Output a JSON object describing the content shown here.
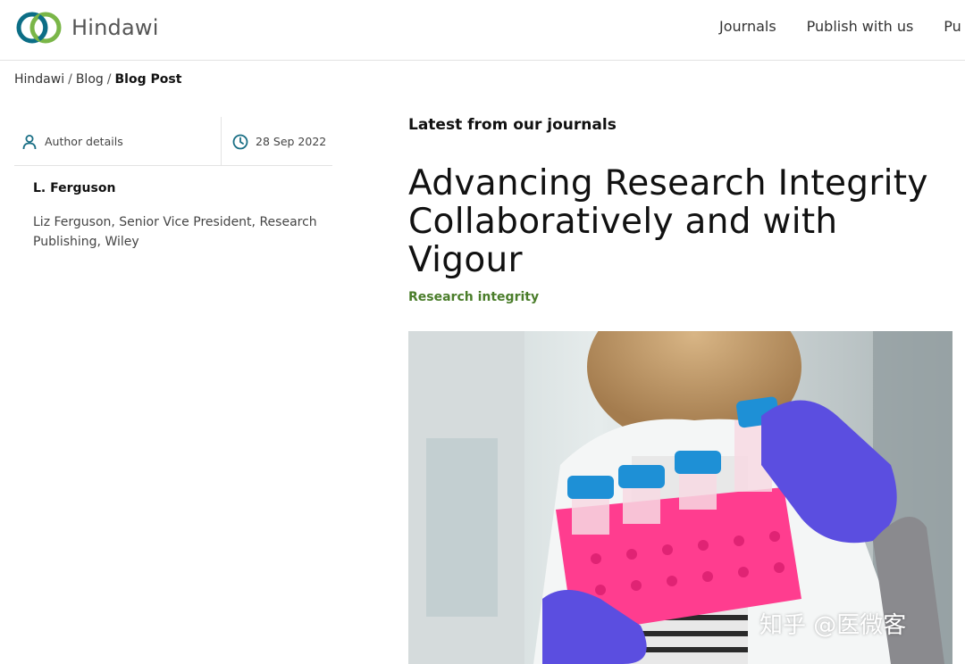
{
  "header": {
    "logo_text": "Hindawi",
    "nav": [
      "Journals",
      "Publish with us",
      "Pu"
    ]
  },
  "breadcrumb": {
    "items": [
      "Hindawi",
      "Blog"
    ],
    "current": "Blog Post",
    "separator": "/"
  },
  "meta": {
    "author_details_label": "Author details",
    "date": "28 Sep 2022"
  },
  "author": {
    "name": "L. Ferguson",
    "bio": "Liz Ferguson, Senior Vice President, Research Publishing, Wiley"
  },
  "article": {
    "section_label": "Latest from our journals",
    "title": "Advancing Research Integrity Collaboratively and with Vigour",
    "category": "Research integrity"
  },
  "watermark": "知乎 @医微客",
  "colors": {
    "brand_teal": "#0c6e86",
    "brand_green": "#7ab648",
    "category_green": "#4a7d2a",
    "icon_teal": "#1a6f85"
  },
  "icons": {
    "author": "person-icon",
    "date": "clock-icon"
  }
}
